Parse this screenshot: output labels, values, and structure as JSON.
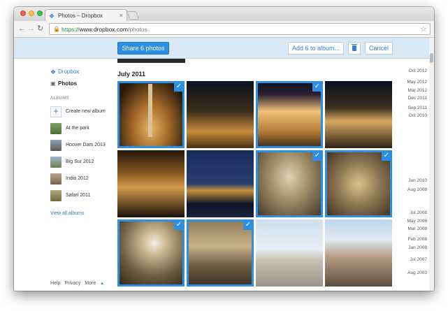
{
  "browser": {
    "tab_title": "Photos – Dropbox",
    "url_scheme": "https://",
    "url_host": "www.dropbox.com",
    "url_path": "/photos"
  },
  "toolbar": {
    "share_label": "Share 6 photos",
    "add_album_label": "Add 6 to album...",
    "cancel_label": "Cancel"
  },
  "sidebar": {
    "dropbox_label": "Dropbox",
    "photos_label": "Photos",
    "albums_heading": "ALBUMS",
    "create_album_label": "Create new album",
    "albums": [
      {
        "label": "At the park"
      },
      {
        "label": "Hoover Dam 2013"
      },
      {
        "label": "Big Sur 2012"
      },
      {
        "label": "India 2012"
      },
      {
        "label": "Safari 2011"
      }
    ],
    "view_all_label": "View all albums",
    "footer": {
      "help": "Help",
      "privacy": "Privacy",
      "more": "More"
    }
  },
  "main": {
    "month_title": "July 2011",
    "photos": [
      {
        "name": "Column and fountain at night",
        "selected": true
      },
      {
        "name": "Piazza at night",
        "selected": false
      },
      {
        "name": "Lit building facade",
        "selected": true
      },
      {
        "name": "Pantheon at night",
        "selected": false
      },
      {
        "name": "Narrow street at night",
        "selected": false
      },
      {
        "name": "River bridge at dusk",
        "selected": false
      },
      {
        "name": "Basilica nave",
        "selected": true
      },
      {
        "name": "Baldachin altar",
        "selected": true
      },
      {
        "name": "Dome interior",
        "selected": true
      },
      {
        "name": "Church interior with crowd",
        "selected": true
      },
      {
        "name": "Square in daylight",
        "selected": false
      },
      {
        "name": "Piazza Navona daytime",
        "selected": false
      }
    ]
  },
  "timeline": [
    "Oct 2012",
    "May 2012",
    "Mar 2012",
    "Dec 2011",
    "Sep 2011",
    "Oct 2010",
    "Jun 2010",
    "Aug 2008",
    "Jul 2008",
    "May 2008",
    "Mar 2008",
    "Feb 2008",
    "Jan 2008",
    "Jul 2007",
    "Aug 2003"
  ],
  "colors": {
    "accent": "#2d8ee2",
    "action_bar": "#d9e8f5",
    "link": "#2d7fcf"
  }
}
